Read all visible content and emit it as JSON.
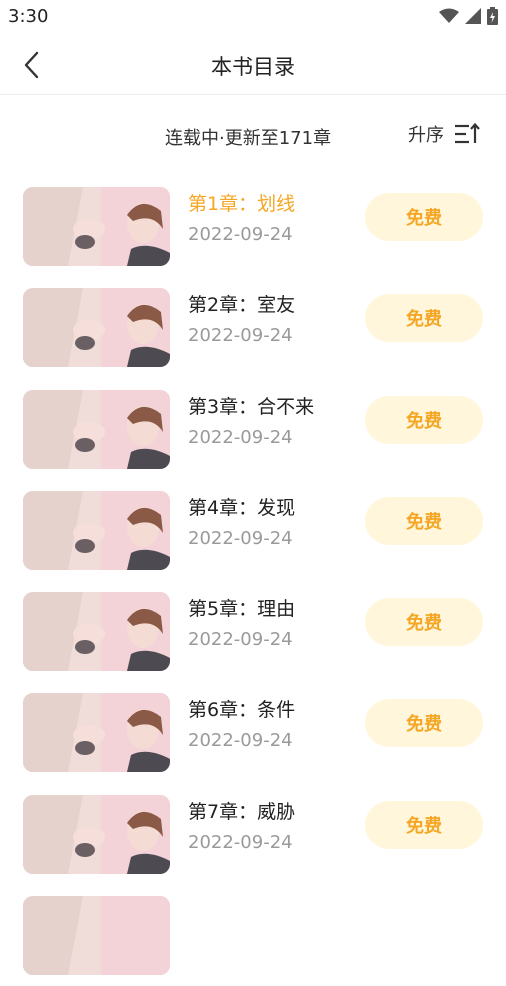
{
  "status_bar": {
    "time": "3:30",
    "icons": [
      "wifi-icon",
      "cellular-signal-icon",
      "battery-charging-icon"
    ]
  },
  "header": {
    "back_icon": "chevron-left-icon",
    "title": "本书目录"
  },
  "sub_header": {
    "update_info": "连载中·更新至171章",
    "sort_label": "升序",
    "sort_icon": "sort-ascending-icon"
  },
  "colors": {
    "accent": "#f5a623",
    "free_button_bg": "#fff6dc",
    "date_text": "#9a9a9a"
  },
  "chapters": [
    {
      "title": "第1章：划线",
      "date": "2022-09-24",
      "badge": "免费",
      "active": true
    },
    {
      "title": "第2章：室友",
      "date": "2022-09-24",
      "badge": "免费",
      "active": false
    },
    {
      "title": "第3章：合不来",
      "date": "2022-09-24",
      "badge": "免费",
      "active": false
    },
    {
      "title": "第4章：发现",
      "date": "2022-09-24",
      "badge": "免费",
      "active": false
    },
    {
      "title": "第5章：理由",
      "date": "2022-09-24",
      "badge": "免费",
      "active": false
    },
    {
      "title": "第6章：条件",
      "date": "2022-09-24",
      "badge": "免费",
      "active": false
    },
    {
      "title": "第7章：威胁",
      "date": "2022-09-24",
      "badge": "免费",
      "active": false
    },
    {
      "title": "",
      "date": "",
      "badge": "",
      "active": false
    }
  ]
}
